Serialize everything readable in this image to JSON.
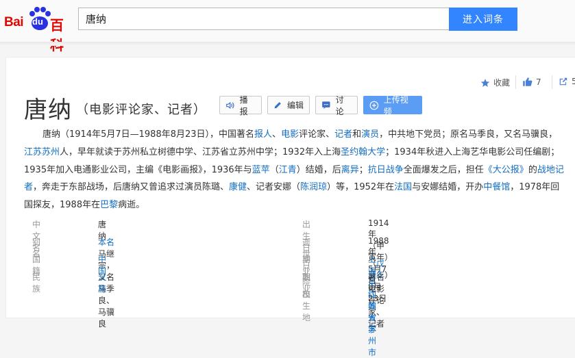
{
  "header": {
    "logo": {
      "bai": "Bai",
      "du": "du",
      "baike": "百科"
    },
    "search": {
      "value": "唐纳",
      "button": "进入词条"
    }
  },
  "tools": {
    "favorite": "收藏",
    "likes": "7",
    "share_count": "5"
  },
  "entry": {
    "title": "唐纳",
    "subtitle": "（电影评论家、记者）",
    "actions": {
      "play": "播报",
      "edit": "编辑",
      "discuss": "讨论",
      "upload": "上传视频"
    }
  },
  "summary": [
    {
      "t": "唐纳（1914年5月7日—1988年8月23日），中国著名"
    },
    {
      "t": "报人",
      "link": true
    },
    {
      "t": "、"
    },
    {
      "t": "电影",
      "link": true
    },
    {
      "t": "评论家、"
    },
    {
      "t": "记者",
      "link": true
    },
    {
      "t": "和"
    },
    {
      "t": "演员",
      "link": true
    },
    {
      "t": "，中共地下党员；原名马季良，又名马骥良，"
    },
    {
      "t": "江苏苏州",
      "link": true
    },
    {
      "t": "人，早年就读于苏州私立树德中学、江苏省立苏州中学；1932年入上海"
    },
    {
      "t": "圣约翰大学",
      "link": true
    },
    {
      "t": "；1934年秋进入上海艺华电影公司任编剧；1935年加入电通影业公司，主编《电影画报》，1936年与"
    },
    {
      "t": "蓝苹",
      "link": true
    },
    {
      "t": "（"
    },
    {
      "t": "江青",
      "link": true
    },
    {
      "t": "）结婚，后"
    },
    {
      "t": "离异",
      "link": true
    },
    {
      "t": "；"
    },
    {
      "t": "抗日战争",
      "link": true
    },
    {
      "t": "全面爆发之后，担任"
    },
    {
      "t": "《大公报》",
      "link": true
    },
    {
      "t": "的"
    },
    {
      "t": "战地记者",
      "link": true
    },
    {
      "t": "，奔走于东部战场，后唐纳又曾追求过演员陈璐、"
    },
    {
      "t": "康健",
      "link": true
    },
    {
      "t": "、记者安娜（"
    },
    {
      "t": "陈润琼",
      "link": true
    },
    {
      "t": "）等，1952年在"
    },
    {
      "t": "法国",
      "link": true
    },
    {
      "t": "与安娜结婚，开办"
    },
    {
      "t": "中餐馆",
      "link": true
    },
    {
      "t": "，1978年回国探友，1988年在"
    },
    {
      "t": "巴黎",
      "link": true
    },
    {
      "t": "病逝。"
    }
  ],
  "basic_info": {
    "left": [
      {
        "k": "中文名",
        "v": [
          {
            "t": "唐纳"
          }
        ]
      },
      {
        "k": "别　名",
        "v": [
          {
            "t": "本名",
            "link": true
          },
          {
            "t": "马继宗，又名马季良、马骥良"
          }
        ]
      },
      {
        "k": "国　籍",
        "v": [
          {
            "t": "中国",
            "link": true
          }
        ]
      },
      {
        "k": "民　族",
        "v": [
          {
            "t": "汉族",
            "link": true
          }
        ]
      }
    ],
    "right": [
      {
        "k": "出生日期",
        "v": [
          {
            "t": "1914年（甲寅年）5月7日"
          }
        ]
      },
      {
        "k": "逝世日期",
        "v": [
          {
            "t": "1988年（"
          },
          {
            "t": "戊辰年",
            "link": true
          },
          {
            "t": "）8月23日"
          }
        ]
      },
      {
        "k": "毕业院校",
        "v": [
          {
            "t": "上海圣约翰大学",
            "link": true
          }
        ]
      },
      {
        "k": "职　业",
        "v": [
          {
            "t": "著名电影评论家、记者"
          }
        ]
      },
      {
        "k": "出生地",
        "v": [
          {
            "t": "江苏省苏州市",
            "link": true
          }
        ]
      }
    ]
  }
}
